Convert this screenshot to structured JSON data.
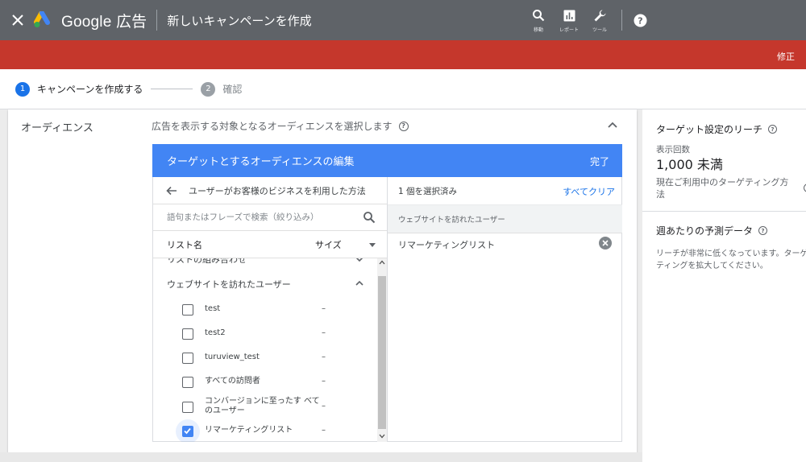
{
  "appbar": {
    "brand": "Google 広告",
    "page_title": "新しいキャンペーンを作成",
    "actions": [
      {
        "label": "移動",
        "icon": "search-icon"
      },
      {
        "label": "レポート",
        "icon": "reports-icon"
      },
      {
        "label": "ツール",
        "icon": "wrench-icon"
      }
    ],
    "help_icon": "help-icon",
    "background": "#5f6368"
  },
  "banner": {
    "action_label": "修正",
    "color": "#c5372c"
  },
  "stepper": {
    "steps": [
      {
        "number": "1",
        "label": "キャンペーンを作成する",
        "active": true
      },
      {
        "number": "2",
        "label": "確認",
        "active": false
      }
    ]
  },
  "section": {
    "label": "オーディエンス",
    "description": "広告を表示する対象となるオーディエンスを選択します"
  },
  "editor": {
    "title": "ターゲットとするオーディエンスの編集",
    "done_label": "完了",
    "header_color": "#4285f4",
    "back_label": "ユーザーがお客様のビジネスを利用した方法",
    "search_placeholder": "語句またはフレーズで検索（絞り込み）",
    "columns": {
      "name": "リスト名",
      "size": "サイズ"
    },
    "partial_row": "リストの組み合わせ",
    "group_label": "ウェブサイトを訪れたユーザー",
    "items": [
      {
        "name": "test",
        "size": "–",
        "checked": false
      },
      {
        "name": "test2",
        "size": "–",
        "checked": false
      },
      {
        "name": "turuview_test",
        "size": "–",
        "checked": false
      },
      {
        "name": "すべての訪問者",
        "size": "–",
        "checked": false
      },
      {
        "name": "コンバージョンに至ったす べてのユーザー",
        "size": "–",
        "checked": false
      },
      {
        "name": "リマーケティングリスト",
        "size": "–",
        "checked": true
      }
    ],
    "selected": {
      "count_label": "1 個を選択済み",
      "clear_label": "すべてクリア",
      "group_label": "ウェブサイトを訪れたユーザー",
      "items": [
        "リマーケティングリスト"
      ]
    }
  },
  "side": {
    "reach_title": "ターゲット設定のリーチ",
    "reach_label": "表示回数",
    "reach_value": "1,000 未満",
    "reach_note": "現在ご利用中のターゲティング方法",
    "forecast_title": "週あたりの予測データ",
    "forecast_line1": "リーチが非常に低くなっています。ターゲ",
    "forecast_line2": "ティングを拡大してください。"
  }
}
